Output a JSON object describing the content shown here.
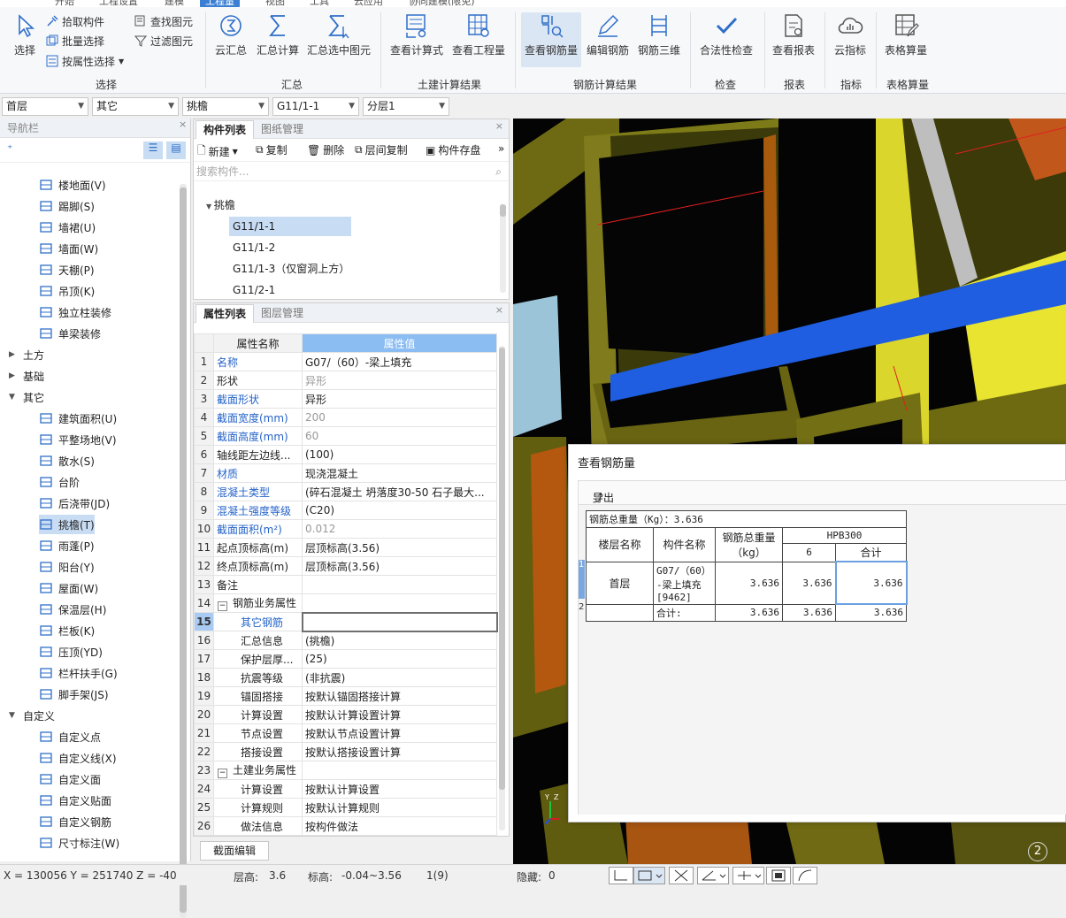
{
  "menu": {
    "items": [
      "开始",
      "工程设置",
      "建模",
      "工程量",
      "视图",
      "工具",
      "云应用",
      "协同建模(限免)"
    ],
    "active": "工程量"
  },
  "ribbon": {
    "select_group": {
      "select": "选择",
      "pick": "拾取构件",
      "batch": "批量选择",
      "by_attr": "按属性选择",
      "find": "查找图元",
      "filter": "过滤图元",
      "label": "选择"
    },
    "summary_group": {
      "cloud": "云汇总",
      "calc": "汇总计算",
      "calc_sel": "汇总选中图元",
      "label": "汇总"
    },
    "civil_group": {
      "formula": "查看计算式",
      "qty": "查看工程量",
      "label": "土建计算结果"
    },
    "rebar_group": {
      "view": "查看钢筋量",
      "edit": "编辑钢筋",
      "three_d": "钢筋三维",
      "label": "钢筋计算结果"
    },
    "check_group": {
      "legal": "合法性检查",
      "label": "检查"
    },
    "report_group": {
      "view": "查看报表",
      "label": "报表"
    },
    "index_group": {
      "cloud": "云指标",
      "label": "指标"
    },
    "table_group": {
      "table": "表格算量",
      "label": "表格算量"
    }
  },
  "combos": [
    "首层",
    "其它",
    "挑檐",
    "G11/1-1",
    "分层1"
  ],
  "nav": {
    "title": "导航栏",
    "items_top": [
      {
        "icon": "floor-icon",
        "label": "楼地面(V)"
      },
      {
        "icon": "skirting-icon",
        "label": "踢脚(S)"
      },
      {
        "icon": "wainscot-icon",
        "label": "墙裙(U)"
      },
      {
        "icon": "wall-face-icon",
        "label": "墙面(W)"
      },
      {
        "icon": "ceiling-icon",
        "label": "天棚(P)"
      },
      {
        "icon": "suspended-ceiling-icon",
        "label": "吊顶(K)"
      },
      {
        "icon": "column-deco-icon",
        "label": "独立柱装修"
      },
      {
        "icon": "beam-deco-icon",
        "label": "单梁装修"
      }
    ],
    "cats": {
      "earth": "土方",
      "foundation": "基础",
      "other": "其它",
      "custom": "自定义"
    },
    "items_other": [
      {
        "icon": "building-area-icon",
        "label": "建筑面积(U)"
      },
      {
        "icon": "site-leveling-icon",
        "label": "平整场地(V)"
      },
      {
        "icon": "apron-icon",
        "label": "散水(S)"
      },
      {
        "icon": "steps-icon",
        "label": "台阶"
      },
      {
        "icon": "post-pour-icon",
        "label": "后浇带(JD)"
      },
      {
        "icon": "cornice-icon",
        "label": "挑檐(T)"
      },
      {
        "icon": "canopy-icon",
        "label": "雨蓬(P)"
      },
      {
        "icon": "balcony-icon",
        "label": "阳台(Y)"
      },
      {
        "icon": "roof-icon",
        "label": "屋面(W)"
      },
      {
        "icon": "insulation-icon",
        "label": "保温层(H)"
      },
      {
        "icon": "fence-board-icon",
        "label": "栏板(K)"
      },
      {
        "icon": "coping-icon",
        "label": "压顶(YD)"
      },
      {
        "icon": "railing-icon",
        "label": "栏杆扶手(G)"
      },
      {
        "icon": "scaffold-icon",
        "label": "脚手架(JS)"
      }
    ],
    "items_custom": [
      {
        "icon": "custom-point-icon",
        "label": "自定义点"
      },
      {
        "icon": "custom-line-icon",
        "label": "自定义线(X)"
      },
      {
        "icon": "custom-face-icon",
        "label": "自定义面"
      },
      {
        "icon": "custom-paste-icon",
        "label": "自定义贴面"
      },
      {
        "icon": "custom-rebar-icon",
        "label": "自定义钢筋"
      },
      {
        "icon": "dimension-icon",
        "label": "尺寸标注(W)"
      }
    ]
  },
  "complist": {
    "tabs": [
      "构件列表",
      "图纸管理"
    ],
    "toolbar": {
      "new": "新建",
      "copy": "复制",
      "delete": "删除",
      "floor_copy": "层间复制",
      "save": "构件存盘"
    },
    "search_placeholder": "搜索构件...",
    "group": "挑檐",
    "items": [
      "G11/1-1",
      "G11/1-2",
      "G11/1-3（仅窗洞上方）",
      "G11/2-1"
    ]
  },
  "props": {
    "tabs": [
      "属性列表",
      "图层管理"
    ],
    "col_name": "属性名称",
    "col_val": "属性值",
    "rows": [
      {
        "n": "1",
        "name": "名称",
        "val": "G07/（60）-梁上填充"
      },
      {
        "n": "2",
        "name": "形状",
        "val": "异形"
      },
      {
        "n": "3",
        "name": "截面形状",
        "val": "异形"
      },
      {
        "n": "4",
        "name": "截面宽度(mm)",
        "val": "200"
      },
      {
        "n": "5",
        "name": "截面高度(mm)",
        "val": "60"
      },
      {
        "n": "6",
        "name": "轴线距左边线...",
        "val": "(100)"
      },
      {
        "n": "7",
        "name": "材质",
        "val": "现浇混凝土"
      },
      {
        "n": "8",
        "name": "混凝土类型",
        "val": "(碎石混凝土 坍落度30-50 石子最大..."
      },
      {
        "n": "9",
        "name": "混凝土强度等级",
        "val": "(C20)"
      },
      {
        "n": "10",
        "name": "截面面积(m²)",
        "val": "0.012"
      },
      {
        "n": "11",
        "name": "起点顶标高(m)",
        "val": "层顶标高(3.56)"
      },
      {
        "n": "12",
        "name": "终点顶标高(m)",
        "val": "层顶标高(3.56)"
      },
      {
        "n": "13",
        "name": "备注",
        "val": ""
      },
      {
        "n": "14",
        "name": "钢筋业务属性",
        "val": ""
      },
      {
        "n": "15",
        "name": "其它钢筋",
        "val": ""
      },
      {
        "n": "16",
        "name": "汇总信息",
        "val": "(挑檐)"
      },
      {
        "n": "17",
        "name": "保护层厚...",
        "val": "(25)"
      },
      {
        "n": "18",
        "name": "抗震等级",
        "val": "(非抗震)"
      },
      {
        "n": "19",
        "name": "锚固搭接",
        "val": "按默认锚固搭接计算"
      },
      {
        "n": "20",
        "name": "计算设置",
        "val": "按默认计算设置计算"
      },
      {
        "n": "21",
        "name": "节点设置",
        "val": "按默认节点设置计算"
      },
      {
        "n": "22",
        "name": "搭接设置",
        "val": "按默认搭接设置计算"
      },
      {
        "n": "23",
        "name": "土建业务属性",
        "val": ""
      },
      {
        "n": "24",
        "name": "计算设置",
        "val": "按默认计算设置"
      },
      {
        "n": "25",
        "name": "计算规则",
        "val": "按默认计算规则"
      },
      {
        "n": "26",
        "name": "做法信息",
        "val": "按构件做法"
      }
    ],
    "section_edit": "截面编辑"
  },
  "dialog": {
    "title": "查看钢筋量",
    "export": "导出到Excel",
    "total_line": "钢筋总重量（Kg）：3.636",
    "headers": {
      "floor": "楼层名称",
      "comp": "构件名称",
      "weight": "钢筋总重量（kg）",
      "grade": "HPB300",
      "dia": "6",
      "sum": "合计"
    },
    "row": {
      "idx": "1",
      "floor": "首层",
      "comp": "G07/（60）-梁上填充[9462]",
      "weight": "3.636",
      "dia": "3.636",
      "sum": "3.636"
    },
    "total": {
      "idx": "2",
      "label": "合计:",
      "weight": "3.636",
      "dia": "3.636",
      "sum": "3.636"
    }
  },
  "view": {
    "page_badge": "2"
  },
  "status": {
    "coords": "X = 130056 Y = 251740 Z = -40",
    "floor_h_label": "层高:",
    "floor_h": "3.6",
    "elev_label": "标高:",
    "elev": "-0.04~3.56",
    "count": "1(9)",
    "hidden_label": "隐藏:",
    "hidden": "0"
  }
}
